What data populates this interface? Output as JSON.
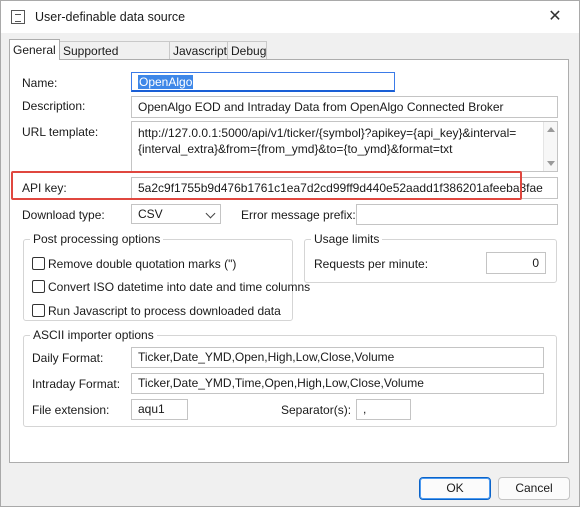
{
  "window": {
    "title": "User-definable data source",
    "close_glyph": "✕"
  },
  "tabs": [
    {
      "label": "General"
    },
    {
      "label": "Supported intervals"
    },
    {
      "label": "Javascript"
    },
    {
      "label": "Debug"
    }
  ],
  "general": {
    "name_label": "Name:",
    "name_value": "OpenAlgo",
    "description_label": "Description:",
    "description_value": "OpenAlgo EOD and Intraday Data from OpenAlgo Connected Broker",
    "url_label": "URL template:",
    "url_value_line1": "http://127.0.0.1:5000/api/v1/ticker/{symbol}?apikey={api_key}&interval=",
    "url_value_line2": "{interval_extra}&from={from_ymd}&to={to_ymd}&format=txt",
    "apikey_label": "API key:",
    "apikey_value": "5a2c9f1755b9d476b1761c1ea7d2cd99ff9d440e52aadd1f386201afeeba3fae",
    "download_type_label": "Download type:",
    "download_type_value": "CSV",
    "error_prefix_label": "Error message prefix:",
    "error_prefix_value": ""
  },
  "post_processing": {
    "title": "Post processing options",
    "options": [
      {
        "label": "Remove double quotation marks (\")",
        "checked": false
      },
      {
        "label": "Convert ISO datetime into date and time columns",
        "checked": false
      },
      {
        "label": "Run Javascript to process downloaded data",
        "checked": false
      }
    ]
  },
  "usage_limits": {
    "title": "Usage limits",
    "requests_label": "Requests per minute:",
    "requests_value": "0"
  },
  "ascii": {
    "title": "ASCII importer options",
    "daily_label": "Daily Format:",
    "daily_value": "Ticker,Date_YMD,Open,High,Low,Close,Volume",
    "intraday_label": "Intraday Format:",
    "intraday_value": "Ticker,Date_YMD,Time,Open,High,Low,Close,Volume",
    "extension_label": "File extension:",
    "extension_value": "aqu1",
    "separator_label": "Separator(s):",
    "separator_value": ","
  },
  "buttons": {
    "ok": "OK",
    "cancel": "Cancel"
  },
  "colors": {
    "highlight_box": "#e0473f",
    "selection": "#3e87e8",
    "default_button": "#0a63c9"
  }
}
